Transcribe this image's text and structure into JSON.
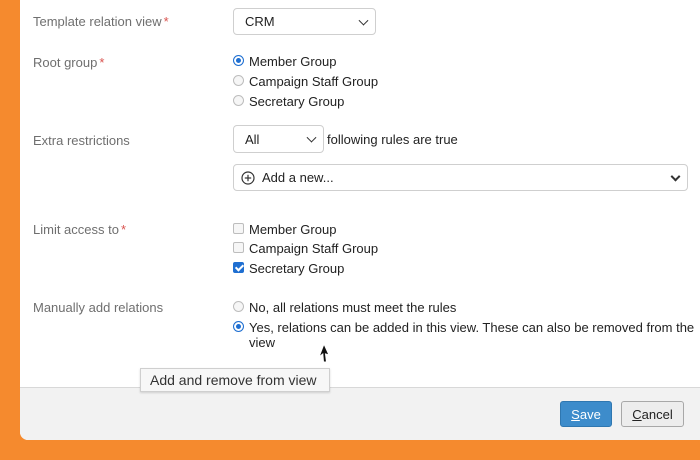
{
  "form": {
    "template_relation_view": {
      "label": "Template relation view",
      "value": "CRM"
    },
    "root_group": {
      "label": "Root group",
      "options": [
        "Member Group",
        "Campaign Staff Group",
        "Secretary Group"
      ],
      "selected": "Member Group"
    },
    "extra_restrictions": {
      "label": "Extra restrictions",
      "mode_value": "All",
      "mode_suffix": "following rules are true",
      "add_placeholder": "Add a new..."
    },
    "limit_access": {
      "label": "Limit access to",
      "options": [
        "Member Group",
        "Campaign Staff Group",
        "Secretary Group"
      ],
      "checked": [
        "Secretary Group"
      ]
    },
    "manual_relations": {
      "label": "Manually add relations",
      "option_no": "No, all relations must meet the rules",
      "option_yes_line1": "Yes, relations can be added in this view. These can also be removed from the",
      "option_yes_line2": "view",
      "selected": "yes"
    },
    "required_mark": "*"
  },
  "footer": {
    "save": {
      "key": "S",
      "rest": "ave"
    },
    "cancel": {
      "key": "C",
      "rest": "ancel"
    }
  },
  "tooltip": {
    "text": "Add and remove from view"
  },
  "colors": {
    "background": "#f58a2e",
    "accent": "#1f6fd1",
    "save_button": "#3d8ccb",
    "required": "#d9534f"
  },
  "icons": {
    "add": "plus-circle-icon",
    "dropdown": "chevron-down-icon",
    "cursor": "mouse-pointer-icon"
  }
}
